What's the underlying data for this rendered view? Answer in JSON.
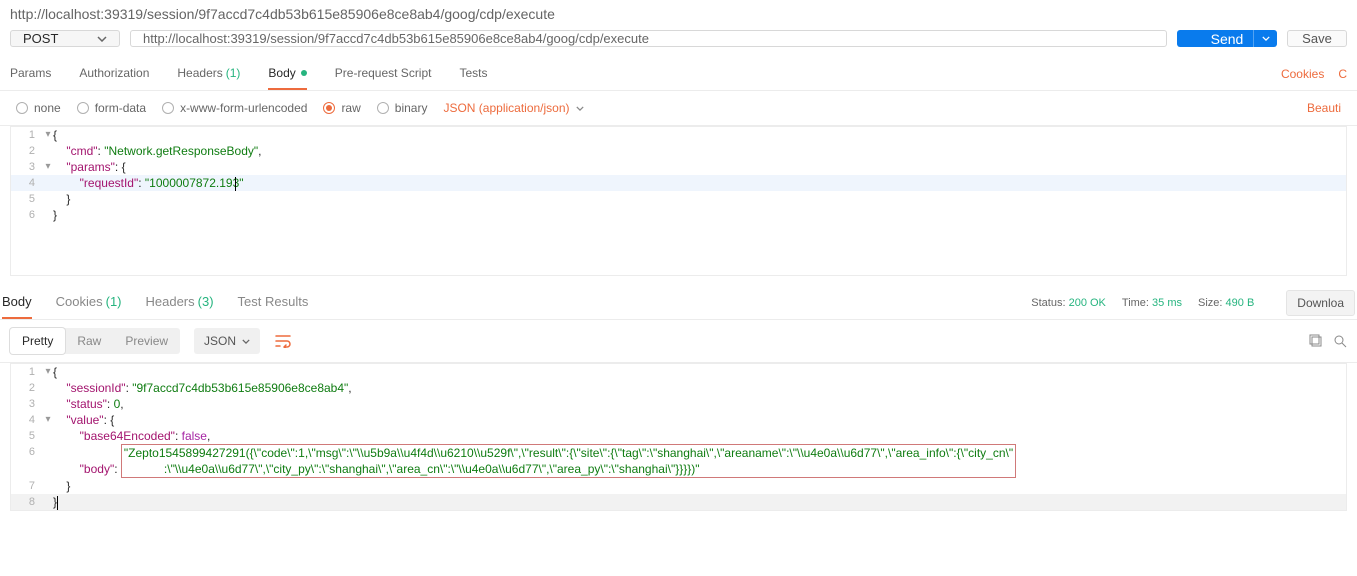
{
  "breadcrumb": "http://localhost:39319/session/9f7accd7c4db53b615e85906e8ce8ab4/goog/cdp/execute",
  "request": {
    "method": "POST",
    "url": "http://localhost:39319/session/9f7accd7c4db53b615e85906e8ce8ab4/goog/cdp/execute",
    "send_label": "Send",
    "save_label": "Save"
  },
  "req_tabs": {
    "params": "Params",
    "authorization": "Authorization",
    "headers": "Headers",
    "headers_count": "(1)",
    "body": "Body",
    "prescript": "Pre-request Script",
    "tests": "Tests",
    "cookies_link": "Cookies",
    "code_link": "C"
  },
  "body_type": {
    "none": "none",
    "form_data": "form-data",
    "urlencoded": "x-www-form-urlencoded",
    "raw": "raw",
    "binary": "binary",
    "content_type": "JSON (application/json)",
    "beautify": "Beauti"
  },
  "req_body_lines": [
    {
      "n": "1",
      "fold": "▾",
      "indent": "",
      "t": "{"
    },
    {
      "n": "2",
      "fold": "",
      "indent": "    ",
      "k": "\"cmd\"",
      "c": ": ",
      "v": "\"Network.getResponseBody\"",
      "tail": ","
    },
    {
      "n": "3",
      "fold": "▾",
      "indent": "    ",
      "k": "\"params\"",
      "c": ": ",
      "t": "{"
    },
    {
      "n": "4",
      "fold": "",
      "indent": "        ",
      "k": "\"requestId\"",
      "c": ": ",
      "v": "\"1000007872.193\"",
      "active": true,
      "cursor": true
    },
    {
      "n": "5",
      "fold": "",
      "indent": "    ",
      "t": "}"
    },
    {
      "n": "6",
      "fold": "",
      "indent": "",
      "t": "}"
    }
  ],
  "resp_tabs": {
    "body": "Body",
    "cookies": "Cookies",
    "cookies_count": "(1)",
    "headers": "Headers",
    "headers_count": "(3)",
    "test_results": "Test Results",
    "status_label": "Status:",
    "status_value": "200 OK",
    "time_label": "Time:",
    "time_value": "35 ms",
    "size_label": "Size:",
    "size_value": "490 B",
    "download": "Downloa"
  },
  "viewmodes": {
    "pretty": "Pretty",
    "raw": "Raw",
    "preview": "Preview",
    "json": "JSON"
  },
  "resp_body": {
    "l1": "{",
    "l2_k": "\"sessionId\"",
    "l2_v": "\"9f7accd7c4db53b615e85906e8ce8ab4\"",
    "l3_k": "\"status\"",
    "l3_v": "0",
    "l4_k": "\"value\"",
    "l4_v": "{",
    "l5_k": "\"base64Encoded\"",
    "l5_v": "false",
    "l6_k": "\"body\"",
    "l6_v_a": "\"Zepto1545899427291({\\\"code\\\":1,\\\"msg\\\":\\\"\\\\u5b9a\\\\u4f4d\\\\u6210\\\\u529f\\\",\\\"result\\\":{\\\"site\\\":{\\\"tag\\\":\\\"shanghai\\\",\\\"areaname\\\":\\\"\\\\u4e0a\\\\u6d77\\\",\\\"area_info\\\":{\\\"city_cn\\\"",
    "l6_v_b": ":\\\"\\\\u4e0a\\\\u6d77\\\",\\\"city_py\\\":\\\"shanghai\\\",\\\"area_cn\\\":\\\"\\\\u4e0a\\\\u6d77\\\",\\\"area_py\\\":\\\"shanghai\\\"}}}})\"",
    "l7": "}",
    "l8": "}"
  }
}
